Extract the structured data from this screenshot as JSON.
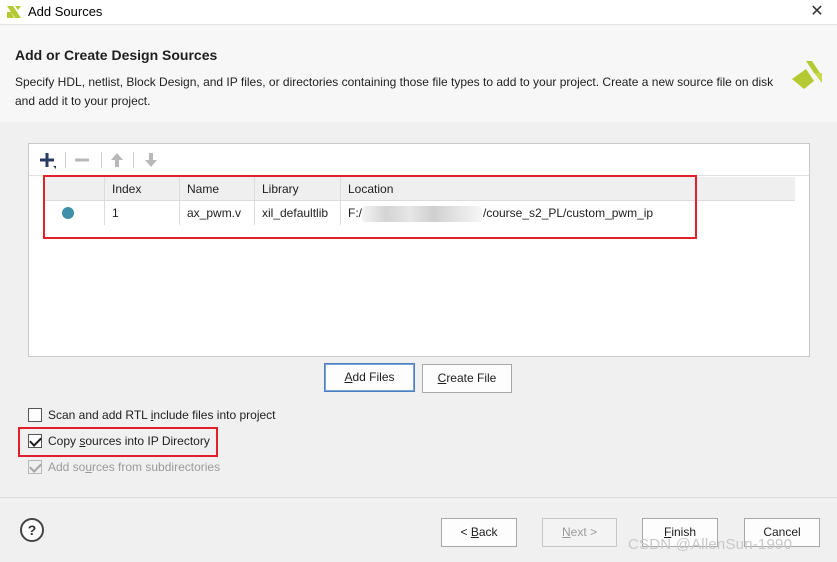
{
  "window": {
    "title": "Add Sources",
    "close_glyph": "✕"
  },
  "header": {
    "title": "Add or Create Design Sources",
    "description": "Specify HDL, netlist, Block Design, and IP files, or directories containing those file types to add to your project. Create a new source file on disk and add it to your project."
  },
  "toolbar": {
    "icons": [
      "add-icon",
      "remove-icon",
      "move-up-icon",
      "move-down-icon"
    ]
  },
  "table": {
    "columns": [
      "",
      "Index",
      "Name",
      "Library",
      "Location"
    ],
    "rows": [
      {
        "status": "file-dot-icon",
        "index": "1",
        "name": "ax_pwm.v",
        "library": "xil_defaultlib",
        "location_prefix": "F:/",
        "location_suffix": "/course_s2_PL/custom_pwm_ip"
      }
    ]
  },
  "buttons": {
    "add_files": {
      "pre": "",
      "ul": "A",
      "post": "dd Files"
    },
    "create_file": {
      "pre": "",
      "ul": "C",
      "post": "reate File"
    },
    "back": {
      "pre": "< ",
      "ul": "B",
      "post": "ack"
    },
    "next": {
      "pre": "",
      "ul": "N",
      "post": "ext >"
    },
    "finish": {
      "pre": "",
      "ul": "F",
      "post": "inish"
    },
    "cancel": "Cancel"
  },
  "options": {
    "scan_rtl": {
      "pre": "Scan and add RTL ",
      "ul": "i",
      "post": "nclude files into project",
      "checked": false
    },
    "copy_sources": {
      "pre": "Copy ",
      "ul": "s",
      "post": "ources into IP Directory",
      "checked": true
    },
    "subdirectories": {
      "pre": "Add so",
      "ul": "u",
      "post": "rces from subdirectories",
      "checked": true,
      "disabled": true
    }
  },
  "help_glyph": "?",
  "watermark": "CSDN @AllenSun-1990",
  "colors": {
    "accent": "#4a7fc1",
    "highlight_box": "#e0202a",
    "status_dot": "#3e90a8",
    "vivado_logo": "#b5c933"
  }
}
